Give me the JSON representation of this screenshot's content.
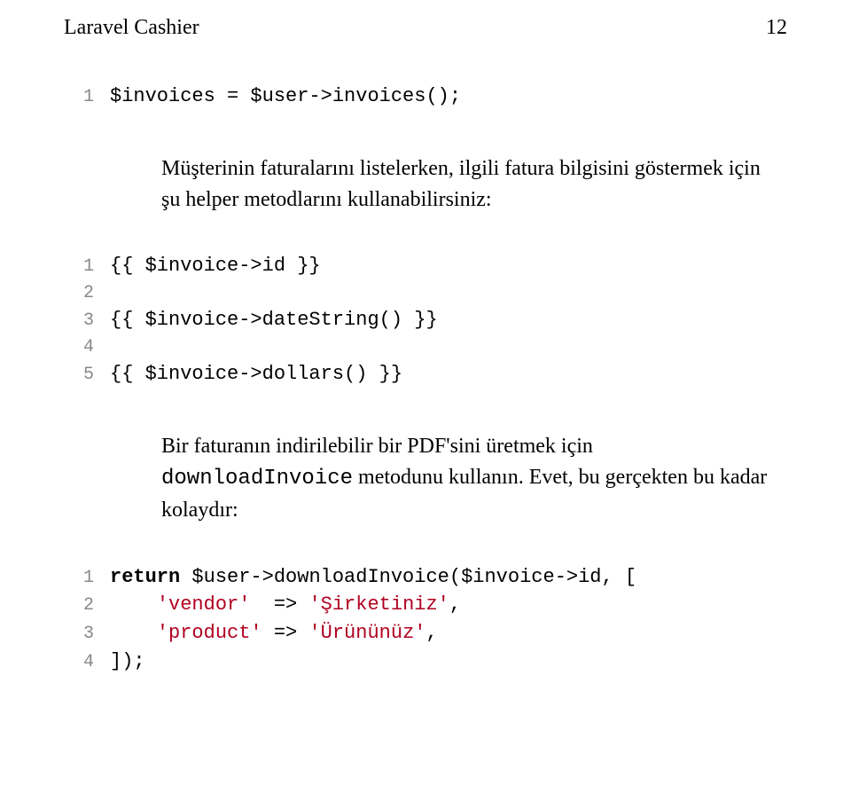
{
  "header": {
    "title": "Laravel Cashier",
    "page_number": "12"
  },
  "para1": "Müşterinin faturalarını listelerken, ilgili fatura bilgisini göstermek için şu helper metodlarını kullanabilirsiniz:",
  "para2_a": "Bir faturanın indirilebilir bir PDF'sini üretmek için ",
  "para2_code": "downloadInvoice",
  "para2_b": " metodunu kullanın. Evet, bu gerçekten bu kadar kolaydır:",
  "codeA": {
    "l1": {
      "n": "1",
      "t": "$invoices = $user->invoices();"
    }
  },
  "codeB": {
    "l1": {
      "n": "1",
      "t": "{{ $invoice->id }}"
    },
    "l2": {
      "n": "2",
      "t": ""
    },
    "l3": {
      "n": "3",
      "t": "{{ $invoice->dateString() }}"
    },
    "l4": {
      "n": "4",
      "t": ""
    },
    "l5": {
      "n": "5",
      "t": "{{ $invoice->dollars() }}"
    }
  },
  "codeC": {
    "l1": {
      "n": "1",
      "kw": "return",
      "rest": " $user->downloadInvoice($invoice->id, ["
    },
    "l2": {
      "n": "2",
      "pre": "    ",
      "s1": "'vendor'",
      "mid": "  => ",
      "s2": "'Şirketiniz'",
      "post": ","
    },
    "l3": {
      "n": "3",
      "pre": "    ",
      "s1": "'product'",
      "mid": " => ",
      "s2": "'Ürününüz'",
      "post": ","
    },
    "l4": {
      "n": "4",
      "t": "]);"
    }
  }
}
